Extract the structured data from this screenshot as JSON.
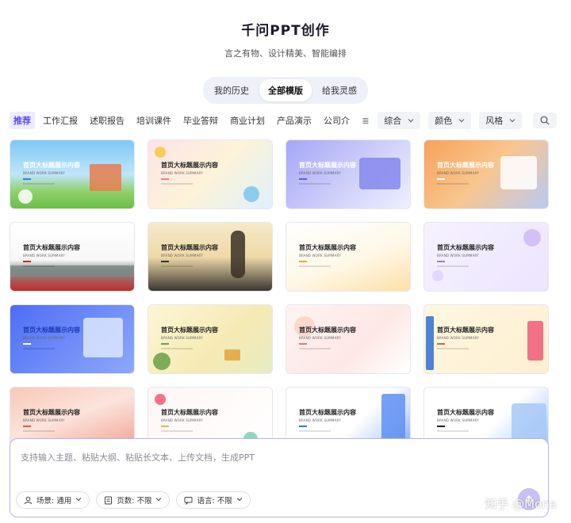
{
  "header": {
    "title": "千问PPT创作",
    "subtitle": "言之有物、设计精美、智能编排"
  },
  "tabs": [
    {
      "label": "我的历史",
      "active": false
    },
    {
      "label": "全部模版",
      "active": true
    },
    {
      "label": "给我灵感",
      "active": false
    }
  ],
  "categories": [
    {
      "label": "推荐",
      "active": true
    },
    {
      "label": "工作汇报",
      "active": false
    },
    {
      "label": "述职报告",
      "active": false
    },
    {
      "label": "培训课件",
      "active": false
    },
    {
      "label": "毕业答辩",
      "active": false
    },
    {
      "label": "商业计划",
      "active": false
    },
    {
      "label": "产品演示",
      "active": false
    },
    {
      "label": "公司介",
      "active": false
    }
  ],
  "category_more": "≣",
  "filters": [
    {
      "label": "综合"
    },
    {
      "label": "颜色"
    },
    {
      "label": "风格"
    }
  ],
  "card_title": "首页大标题展示内容",
  "card_subtitle": "BRAND WORK SUMMARY",
  "cards": [
    {
      "bg": "linear-gradient(180deg,#7ec8f5 0%,#bfe5fb 50%,#8fd16a 75%,#6bbf4a 100%)",
      "accent": "#2f7df6",
      "title_color": "#ffffff"
    },
    {
      "bg": "linear-gradient(135deg,#fde3e8,#fdf3d8 50%,#dff0fb)",
      "accent": "#f07aa0",
      "title_color": "#222222"
    },
    {
      "bg": "linear-gradient(135deg,#a5a6f6,#d2d4fb 60%,#eef0ff)",
      "accent": "#5b5fe0",
      "title_color": "#ffffff"
    },
    {
      "bg": "linear-gradient(135deg,#f7a25b,#f9c68f 50%,#b9c9f5)",
      "accent": "#ffffff",
      "title_color": "#ffffff"
    },
    {
      "bg": "linear-gradient(180deg,#ffffff 0%,#f7f7f7 55%,#8a8f8c 70%,#c42828 100%)",
      "accent": "#c42828",
      "title_color": "#222222"
    },
    {
      "bg": "linear-gradient(180deg,#f6e9c9 0%,#efd9a7 50%,#3a3630 100%)",
      "accent": "#333333",
      "title_color": "#222222"
    },
    {
      "bg": "linear-gradient(160deg,#ffffff 0%,#fff8e8 55%,#fbe0a8 100%)",
      "accent": "#e6a93a",
      "title_color": "#222222"
    },
    {
      "bg": "linear-gradient(135deg,#f6f2ff,#ece4ff)",
      "accent": "#9a7be8",
      "title_color": "#222222"
    },
    {
      "bg": "linear-gradient(135deg,#4d6ef5,#8ea8fb)",
      "accent": "#ffffff",
      "title_color": "#1a3ab8"
    },
    {
      "bg": "linear-gradient(135deg,#fbf6d6,#f6eab3 60%,#e6ecc3)",
      "accent": "#6aa046",
      "title_color": "#222222"
    },
    {
      "bg": "linear-gradient(135deg,#fff4f1,#fde8e4 60%,#fff)",
      "accent": "#f07a5a",
      "title_color": "#222222"
    },
    {
      "bg": "linear-gradient(135deg,#fff7e2,#fdefd0)",
      "accent": "#e35b4c",
      "title_color": "#222222"
    },
    {
      "bg": "linear-gradient(160deg,#f7c9b6 0%,#fbe4dc 45%,#f09a8c 100%)",
      "accent": "#e35b4c",
      "title_color": "#222222"
    },
    {
      "bg": "linear-gradient(135deg,#fff6f6,#fff)",
      "accent": "#f2b23a",
      "title_color": "#222222"
    },
    {
      "bg": "linear-gradient(135deg,#ffffff 55%,#cfe0ff 75%,#6f9bf5 100%)",
      "accent": "#3a6ef0",
      "title_color": "#222222"
    },
    {
      "bg": "linear-gradient(135deg,#ffffff 55%,#cfe3ff 75%,#93bdf7 100%)",
      "accent": "#1f1f1f",
      "title_color": "#222222"
    }
  ],
  "composer": {
    "placeholder": "支持输入主题、粘贴大纲、粘贴长文本、上传文档，生成PPT",
    "chips": [
      {
        "label": "场景: 通用",
        "icon": "user-icon"
      },
      {
        "label": "页数: 不限",
        "icon": "page-icon"
      },
      {
        "label": "语言: 不限",
        "icon": "chat-icon"
      }
    ]
  },
  "watermark": "知乎 @Mona",
  "colors": {
    "accent": "#5a4de8",
    "composer_border": "#b9b2f0",
    "send_button": "#c8c0f4"
  }
}
